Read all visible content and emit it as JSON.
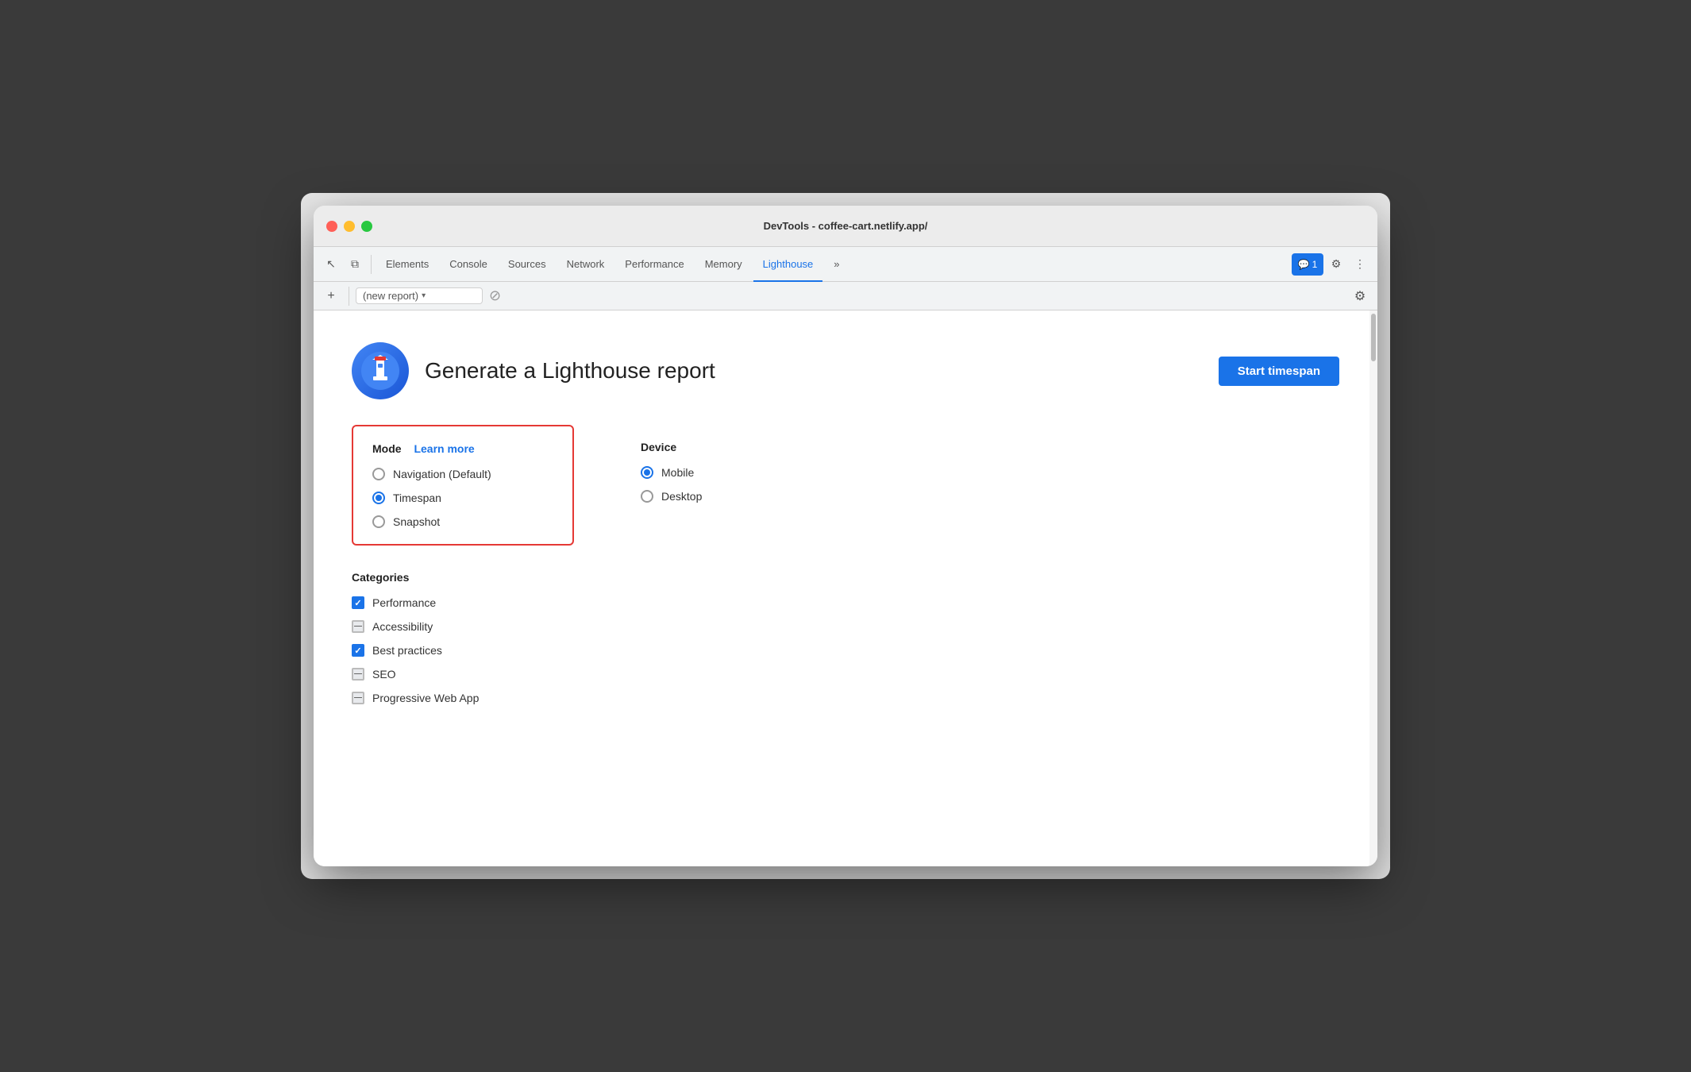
{
  "window": {
    "title": "DevTools - coffee-cart.netlify.app/"
  },
  "tabs": [
    {
      "id": "elements",
      "label": "Elements",
      "active": false
    },
    {
      "id": "console",
      "label": "Console",
      "active": false
    },
    {
      "id": "sources",
      "label": "Sources",
      "active": false
    },
    {
      "id": "network",
      "label": "Network",
      "active": false
    },
    {
      "id": "performance",
      "label": "Performance",
      "active": false
    },
    {
      "id": "memory",
      "label": "Memory",
      "active": false
    },
    {
      "id": "lighthouse",
      "label": "Lighthouse",
      "active": true
    }
  ],
  "toolbar": {
    "new_report": "(new report)",
    "settings_tooltip": "Settings"
  },
  "badge": {
    "icon": "💬",
    "count": "1"
  },
  "header": {
    "title": "Generate a Lighthouse report",
    "start_button": "Start timespan"
  },
  "mode_section": {
    "title": "Mode",
    "learn_more": "Learn more",
    "options": [
      {
        "id": "navigation",
        "label": "Navigation (Default)",
        "selected": false
      },
      {
        "id": "timespan",
        "label": "Timespan",
        "selected": true
      },
      {
        "id": "snapshot",
        "label": "Snapshot",
        "selected": false
      }
    ]
  },
  "device_section": {
    "title": "Device",
    "options": [
      {
        "id": "mobile",
        "label": "Mobile",
        "selected": true
      },
      {
        "id": "desktop",
        "label": "Desktop",
        "selected": false
      }
    ]
  },
  "categories_section": {
    "title": "Categories",
    "items": [
      {
        "id": "performance",
        "label": "Performance",
        "state": "checked"
      },
      {
        "id": "accessibility",
        "label": "Accessibility",
        "state": "indeterminate"
      },
      {
        "id": "best-practices",
        "label": "Best practices",
        "state": "checked"
      },
      {
        "id": "seo",
        "label": "SEO",
        "state": "indeterminate"
      },
      {
        "id": "pwa",
        "label": "Progressive Web App",
        "state": "indeterminate"
      }
    ]
  },
  "icons": {
    "cursor": "↖",
    "layers": "⧉",
    "more": "⋮",
    "gear": "⚙",
    "plus": "+",
    "dropdown": "▾",
    "cancel": "⊘"
  }
}
